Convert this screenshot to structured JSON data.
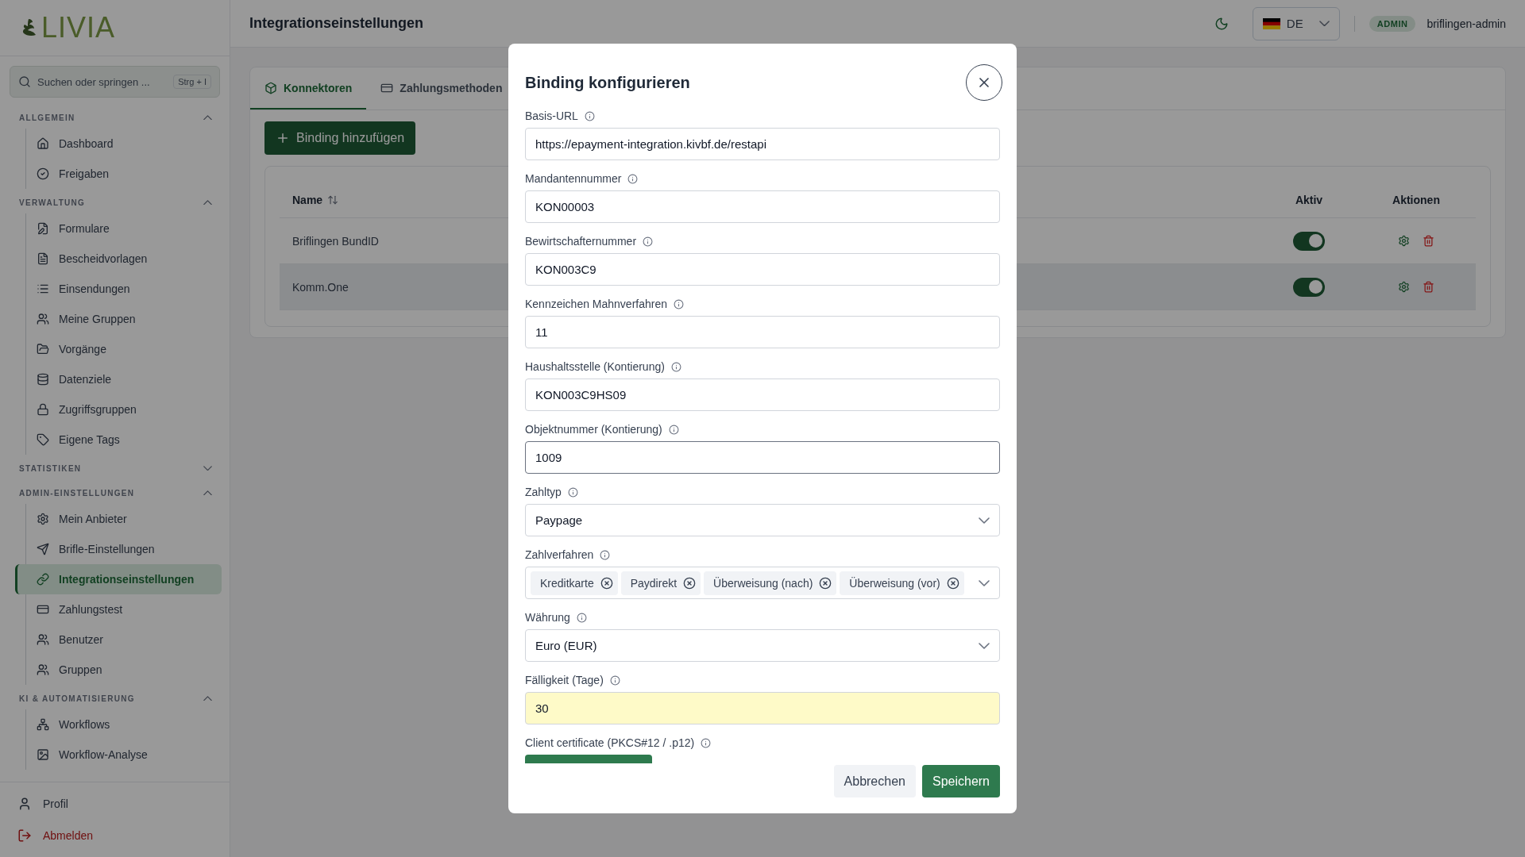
{
  "sidebar": {
    "logo": "LIVIA",
    "search": {
      "placeholder": "Suchen oder springen ...",
      "shortcut": "Strg + I"
    },
    "sections": [
      {
        "title": "ALLGEMEIN",
        "expanded": true,
        "items": [
          {
            "label": "Dashboard",
            "selected": false
          },
          {
            "label": "Freigaben",
            "selected": false
          }
        ]
      },
      {
        "title": "VERWALTUNG",
        "expanded": true,
        "items": [
          {
            "label": "Formulare",
            "selected": false
          },
          {
            "label": "Bescheidvorlagen",
            "selected": false
          },
          {
            "label": "Einsendungen",
            "selected": false
          },
          {
            "label": "Meine Gruppen",
            "selected": false
          },
          {
            "label": "Vorgänge",
            "selected": false
          },
          {
            "label": "Datenziele",
            "selected": false
          },
          {
            "label": "Zugriffsgruppen",
            "selected": false
          },
          {
            "label": "Eigene Tags",
            "selected": false
          }
        ]
      },
      {
        "title": "STATISTIKEN",
        "expanded": false
      },
      {
        "title": "ADMIN-EINSTELLUNGEN",
        "expanded": true,
        "items": [
          {
            "label": "Mein Anbieter",
            "selected": false
          },
          {
            "label": "Brifle-Einstellungen",
            "selected": false
          },
          {
            "label": "Integrationseinstellungen",
            "selected": true
          },
          {
            "label": "Zahlungstest",
            "selected": false
          },
          {
            "label": "Benutzer",
            "selected": false
          },
          {
            "label": "Gruppen",
            "selected": false
          }
        ]
      },
      {
        "title": "KI & AUTOMATISIERUNG",
        "expanded": true,
        "items": [
          {
            "label": "Workflows",
            "selected": false
          },
          {
            "label": "Workflow-Analyse",
            "selected": false
          }
        ]
      }
    ],
    "footer": [
      {
        "label": "Profil",
        "kind": "normal"
      },
      {
        "label": "Abmelden",
        "kind": "danger"
      }
    ]
  },
  "header": {
    "title": "Integrationseinstellungen",
    "language": "DE",
    "role": "ADMIN",
    "user": "briflingen-admin"
  },
  "tabs": [
    {
      "label": "Konnektoren",
      "selected": true
    },
    {
      "label": "Zahlungsmethoden",
      "selected": false
    }
  ],
  "add_button": "Binding hinzufügen",
  "table": {
    "columns": [
      {
        "label": "Name",
        "sortable": true
      },
      {
        "label": "Aktiv",
        "sortable": false
      },
      {
        "label": "Aktionen",
        "sortable": false
      }
    ],
    "rows": [
      {
        "name": "Briflingen BundID",
        "active": true,
        "hovered": false
      },
      {
        "name": "Komm.One",
        "active": true,
        "hovered": true
      }
    ]
  },
  "dialog": {
    "title": "Binding konfigurieren",
    "fields": [
      {
        "kind": "text",
        "label": "Basis-URL",
        "value": "https://epayment-integration.kivbf.de/restapi",
        "focused": false,
        "autofilled": false
      },
      {
        "kind": "text",
        "label": "Mandantennummer",
        "value": "KON00003",
        "focused": false,
        "autofilled": false
      },
      {
        "kind": "text",
        "label": "Bewirtschafternummer",
        "value": "KON003C9",
        "focused": false,
        "autofilled": false
      },
      {
        "kind": "text",
        "label": "Kennzeichen Mahnverfahren",
        "value": "11",
        "focused": false,
        "autofilled": false
      },
      {
        "kind": "text",
        "label": "Haushaltsstelle (Kontierung)",
        "value": "KON003C9HS09",
        "focused": false,
        "autofilled": false
      },
      {
        "kind": "text",
        "label": "Objektnummer (Kontierung)",
        "value": "1009",
        "focused": true,
        "autofilled": false
      },
      {
        "kind": "select",
        "label": "Zahltyp",
        "value": "Paypage"
      },
      {
        "kind": "multiselect",
        "label": "Zahlverfahren",
        "chips": [
          "Kreditkarte",
          "Paydirekt",
          "Überweisung (nach)",
          "Überweisung (vor)"
        ]
      },
      {
        "kind": "select",
        "label": "Währung",
        "value": "Euro (EUR)"
      },
      {
        "kind": "text",
        "label": "Fälligkeit (Tage)",
        "value": "30",
        "focused": false,
        "autofilled": true
      },
      {
        "kind": "file",
        "label": "Client certificate (PKCS#12 / .p12)"
      }
    ],
    "buttons": [
      {
        "label": "Abbrechen",
        "kind": "secondary"
      },
      {
        "label": "Speichern",
        "kind": "primary"
      }
    ]
  }
}
